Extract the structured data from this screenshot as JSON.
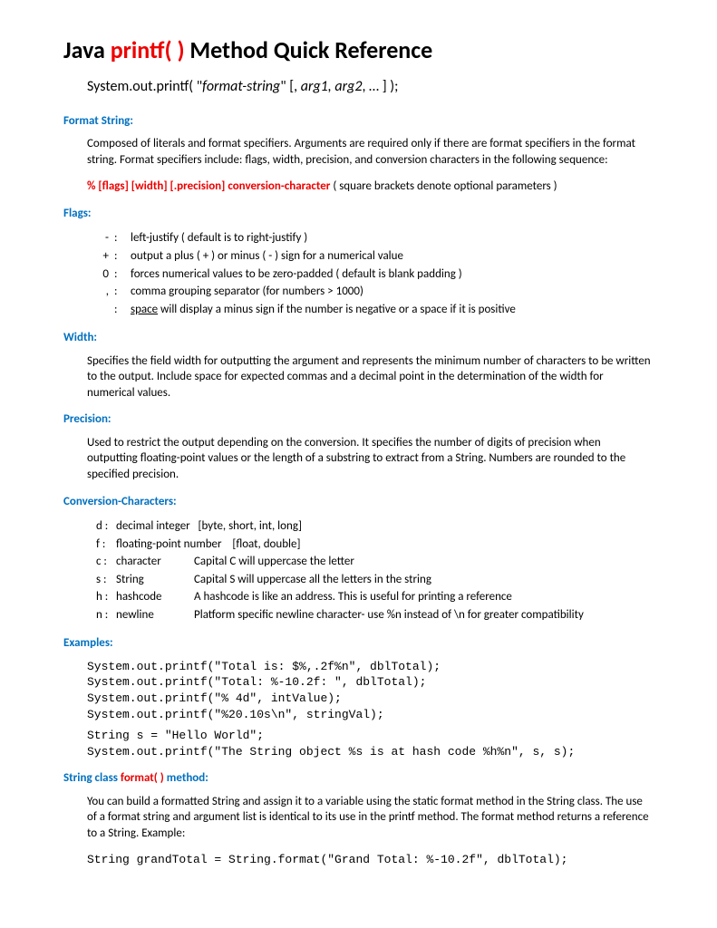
{
  "title": {
    "p1": "Java ",
    "p2": "printf( )",
    "p3": " Method Quick Reference"
  },
  "syntax": {
    "pre": "System.out.printf( \"",
    "mid": "format-string",
    "post1": "\" [, ",
    "args": "arg1, arg2",
    "post2": ", … ] );"
  },
  "formatString": {
    "head": "Format String:",
    "body": "Composed of literals and format specifiers.  Arguments are required only if there are format specifiers in the format string. Format specifiers include: flags, width, precision, and conversion characters in the following sequence:",
    "spec": "% [flags] [width] [.precision] conversion-character",
    "note": "   ( square brackets denote optional parameters )"
  },
  "flags": {
    "head": "Flags:",
    "rows": [
      {
        "sym": "-",
        "desc": "left-justify ( default is to right-justify )"
      },
      {
        "sym": "+",
        "desc": "output a plus ( + ) or minus ( - ) sign for a numerical value"
      },
      {
        "sym": "0",
        "desc": "forces numerical values to be zero-padded ( default is blank padding )"
      },
      {
        "sym": ",",
        "desc": "comma grouping separator (for numbers > 1000)"
      },
      {
        "sym": "",
        "desc_pre": "",
        "desc_u": "space",
        "desc_post": " will display a minus sign if the number is negative or a space if it is positive"
      }
    ]
  },
  "width": {
    "head": "Width:",
    "body": "Specifies the field width for outputting the argument and represents the minimum number of characters to be written to the output. Include space for expected commas and a decimal point in the determination of the width for numerical values."
  },
  "precision": {
    "head": "Precision:",
    "body": "Used to restrict the output depending on the conversion. It specifies the number of digits of precision when outputting floating-point values or the length of a substring to extract from a String. Numbers are rounded to the specified precision."
  },
  "conv": {
    "head": "Conversion-Characters:",
    "rows": [
      {
        "c": "d :",
        "n": "decimal integer",
        "d": "[byte, short, int, long]"
      },
      {
        "c": "f :",
        "n": "floating-point number",
        "d": "[float, double]"
      },
      {
        "c": "c :",
        "n": "character",
        "d": "Capital C will uppercase the letter"
      },
      {
        "c": "s :",
        "n": "String",
        "d": "Capital S will uppercase all the letters in the string"
      },
      {
        "c": "h :",
        "n": "hashcode",
        "d": "A hashcode is like an address. This is useful for printing  a reference"
      },
      {
        "c": "n  :",
        "n": "newline",
        "d": "Platform specific newline character- use %n instead of \\n for greater compatibility"
      }
    ]
  },
  "examples": {
    "head": "Examples:",
    "code1": "System.out.printf(\"Total is: $%,.2f%n\", dblTotal);\nSystem.out.printf(\"Total: %-10.2f: \", dblTotal);\nSystem.out.printf(\"% 4d\", intValue);\nSystem.out.printf(\"%20.10s\\n\", stringVal);",
    "code2": "String s = \"Hello World\";\nSystem.out.printf(\"The String object %s is at hash code %h%n\", s, s);"
  },
  "stringClass": {
    "head_p1": "String class ",
    "head_p2": "format( )",
    "head_p3": " method:",
    "body": "You can build a formatted String and assign it to a variable using the static format method in the String class. The use of a format string and argument list is identical to its use in the printf method. The format method returns a reference to a String. Example:",
    "code": "String grandTotal = String.format(\"Grand Total: %-10.2f\", dblTotal);"
  }
}
